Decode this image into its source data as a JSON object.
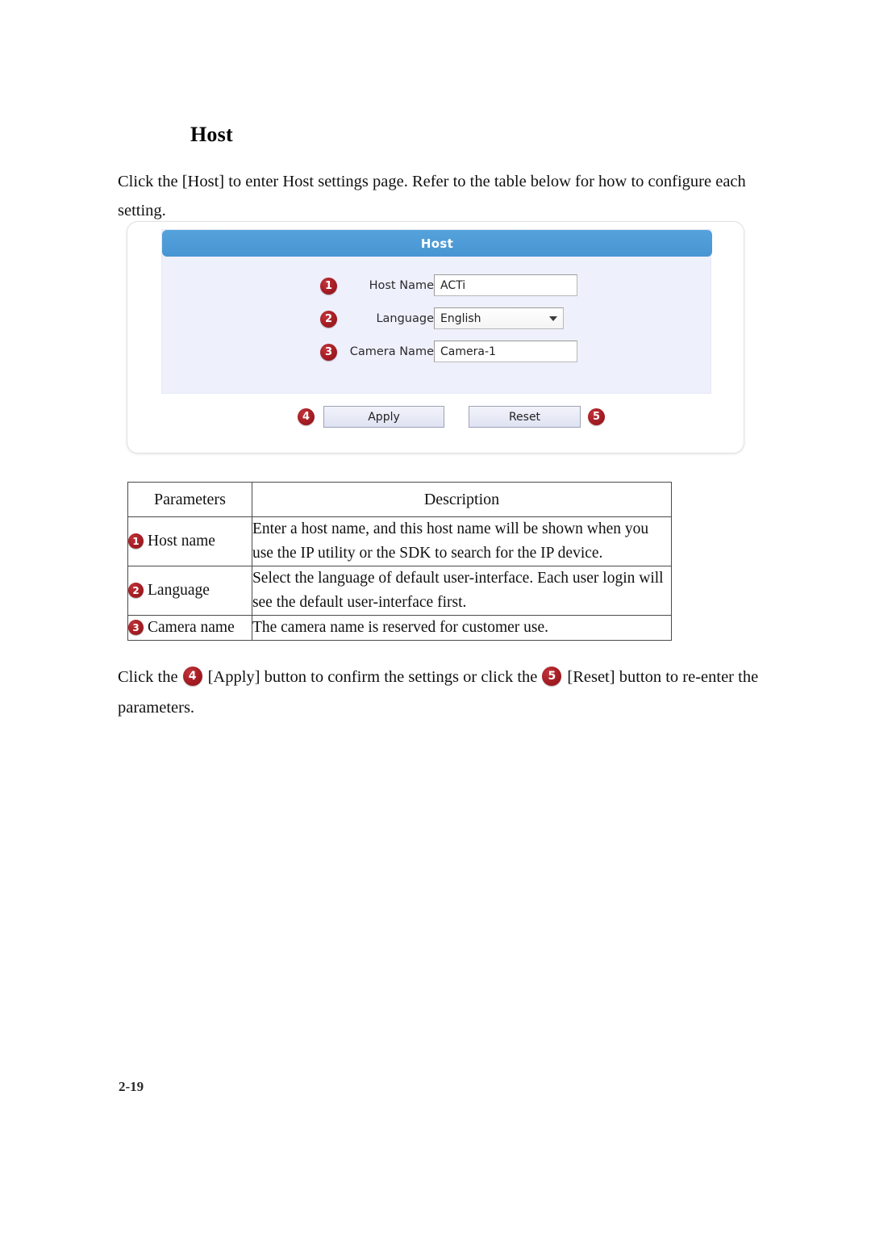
{
  "document": {
    "heading": "Host",
    "intro_paragraph": "Click the [Host] to enter Host settings page. Refer to the table below for how to configure each setting.",
    "page_number": "2-19"
  },
  "screenshot": {
    "panel_title": "Host",
    "accent_color": "#4d9bd8",
    "panel_background": "#eef0fc",
    "badge_color": "#a81f26",
    "fields": [
      {
        "badge": "1",
        "label": "Host Name",
        "type": "text",
        "value": "ACTi"
      },
      {
        "badge": "2",
        "label": "Language",
        "type": "select",
        "value": "English"
      },
      {
        "badge": "3",
        "label": "Camera Name",
        "type": "text",
        "value": "Camera-1"
      }
    ],
    "buttons": {
      "apply_badge": "4",
      "apply_label": "Apply",
      "reset_label": "Reset",
      "reset_badge": "5"
    }
  },
  "table": {
    "headers": {
      "parameters": "Parameters",
      "description": "Description"
    },
    "rows": [
      {
        "badge": "1",
        "parameter": "Host name",
        "description": "Enter a host name, and this host name will be shown when you use the IP utility or the SDK to search for the IP device."
      },
      {
        "badge": "2",
        "parameter": "Language",
        "description": "Select the language of default user-interface. Each user login will see the default user-interface first."
      },
      {
        "badge": "3",
        "parameter": "Camera name",
        "description": "The camera name is reserved for customer use."
      }
    ]
  },
  "closing": {
    "part1": "Click the",
    "badge1": "4",
    "part2": "[Apply] button to confirm the settings or click the",
    "badge2": "5",
    "part3": "[Reset] button to re-enter the parameters."
  }
}
